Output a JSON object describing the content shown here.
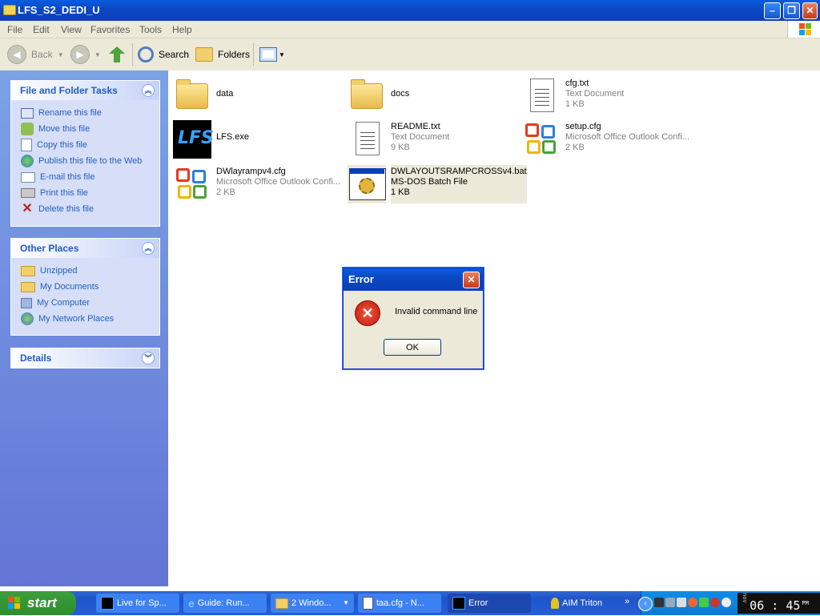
{
  "window": {
    "title": "LFS_S2_DEDI_U"
  },
  "menu": [
    "File",
    "Edit",
    "View",
    "Favorites",
    "Tools",
    "Help"
  ],
  "toolbar": {
    "back": "Back",
    "search": "Search",
    "folders": "Folders"
  },
  "sidebar": {
    "tasks": {
      "title": "File and Folder Tasks",
      "items": [
        {
          "label": "Rename this file",
          "icon": "rename-icon"
        },
        {
          "label": "Move this file",
          "icon": "move-icon"
        },
        {
          "label": "Copy this file",
          "icon": "copy-icon"
        },
        {
          "label": "Publish this file to the Web",
          "icon": "globe-icon"
        },
        {
          "label": "E-mail this file",
          "icon": "mail-icon"
        },
        {
          "label": "Print this file",
          "icon": "printer-icon"
        },
        {
          "label": "Delete this file",
          "icon": "delete-icon"
        }
      ]
    },
    "places": {
      "title": "Other Places",
      "items": [
        {
          "label": "Unzipped",
          "icon": "folder-icon"
        },
        {
          "label": "My Documents",
          "icon": "documents-icon"
        },
        {
          "label": "My Computer",
          "icon": "computer-icon"
        },
        {
          "label": "My Network Places",
          "icon": "network-icon"
        }
      ]
    },
    "details": {
      "title": "Details"
    }
  },
  "files": [
    {
      "name": "data",
      "type": "",
      "size": "",
      "icon": "folder-icon"
    },
    {
      "name": "docs",
      "type": "",
      "size": "",
      "icon": "folder-icon"
    },
    {
      "name": "cfg.txt",
      "type": "Text Document",
      "size": "1 KB",
      "icon": "notepad-icon"
    },
    {
      "name": "LFS.exe",
      "type": "",
      "size": "",
      "icon": "lfs-app-icon"
    },
    {
      "name": "README.txt",
      "type": "Text Document",
      "size": "9 KB",
      "icon": "notepad-icon"
    },
    {
      "name": "setup.cfg",
      "type": "Microsoft Office Outlook Confi...",
      "size": "2 KB",
      "icon": "office-icon"
    },
    {
      "name": "DWlayrampv4.cfg",
      "type": "Microsoft Office Outlook Confi...",
      "size": "2 KB",
      "icon": "office-icon"
    },
    {
      "name": "DWLAYOUTSRAMPCROSSv4.bat",
      "type": "MS-DOS Batch File",
      "size": "1 KB",
      "icon": "batch-icon"
    }
  ],
  "dialog": {
    "title": "Error",
    "message": "Invalid command line",
    "ok": "OK"
  },
  "taskbar": {
    "start": "start",
    "tasks": [
      "Live for Sp...",
      "Guide: Run...",
      "2 Windo...",
      "taa.cfg - N...",
      "Error"
    ],
    "aim": "AIM Triton",
    "clock": "06 : 45",
    "clock_ampm": "PM",
    "clock_side": "nov"
  },
  "colors": {
    "accent": "#0a5ddf",
    "link": "#215dc6",
    "sidebar": "#7ba2e7",
    "start": "#3c9e3c"
  }
}
